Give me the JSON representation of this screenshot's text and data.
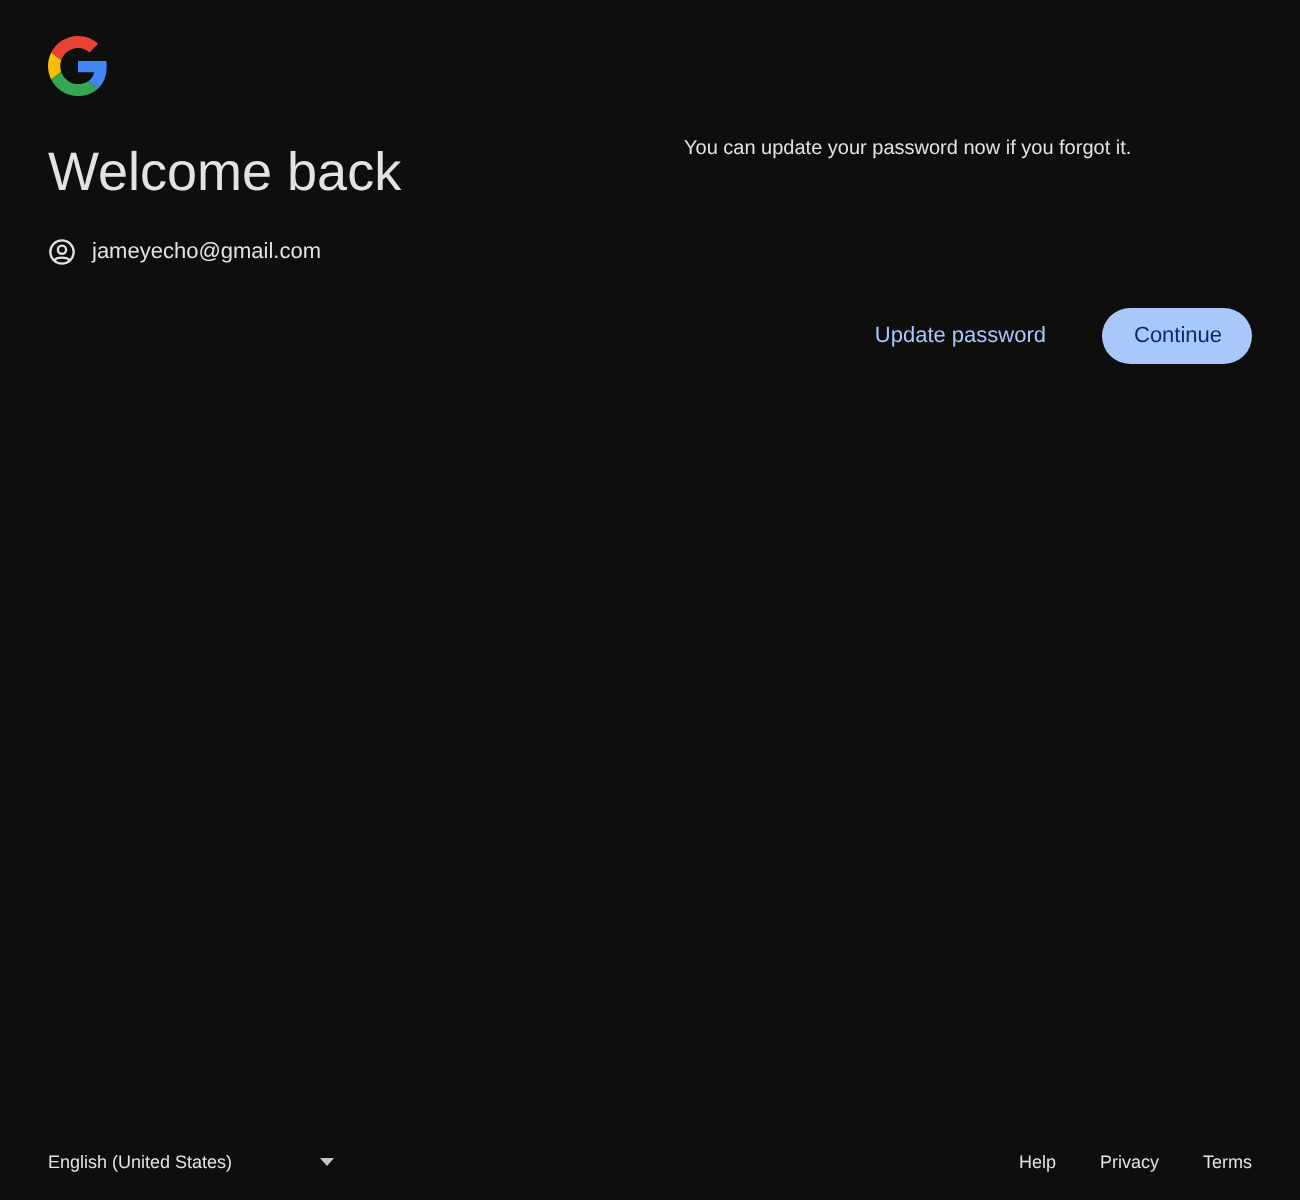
{
  "title": "Welcome back",
  "account": {
    "email": "jameyecho@gmail.com"
  },
  "message": "You can update your password now if you forgot it.",
  "buttons": [
    {
      "label": "Update password",
      "kind": "text"
    },
    {
      "label": "Continue",
      "kind": "filled"
    }
  ],
  "footer": {
    "language": "English (United States)",
    "links": [
      "Help",
      "Privacy",
      "Terms"
    ]
  }
}
